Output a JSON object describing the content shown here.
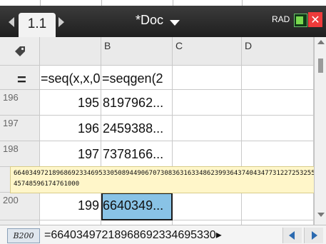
{
  "tabbar": {
    "tab_label": "1.1",
    "document_title": "*Doc",
    "mode": "RAD"
  },
  "columns": [
    "",
    "B",
    "C",
    "D"
  ],
  "formulas": {
    "a": "=seq(x,x,0",
    "b": "=seqgen(2"
  },
  "rows": [
    {
      "n": "196",
      "a": "195",
      "b": "8197962..."
    },
    {
      "n": "197",
      "a": "196",
      "b": "2459388..."
    },
    {
      "n": "198",
      "a": "197",
      "b": "7378166..."
    },
    {
      "n": "200",
      "a": "199",
      "b": "6640349..."
    }
  ],
  "tooltip": {
    "value": "66403497218968692334695330508944906707308363163348623993643740434773122725325545748596174761000"
  },
  "entry_line": {
    "cell_ref": "B200",
    "text": "=66403497218968692334695330▸"
  },
  "colors": {
    "selected_cell": "#89c3e6",
    "tooltip_bg": "#fff6c9",
    "titlebar": "#2a2a2a"
  },
  "icons": {
    "left_arrow": "left-arrow-icon",
    "right_arrow": "right-arrow-icon",
    "doc_menu": "chevron-down-icon",
    "battery": "battery-icon",
    "close": "close-icon",
    "tag": "tag-icon",
    "formula_row": "equals-icon"
  }
}
